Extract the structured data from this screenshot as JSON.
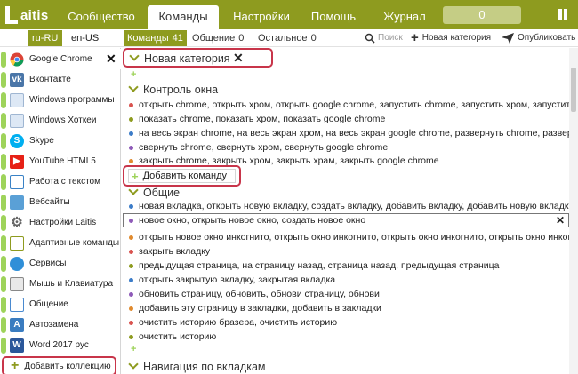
{
  "app": {
    "logo_text": "aitis",
    "logo_color": "#8e9b1f"
  },
  "nav": {
    "tabs": [
      {
        "label": "Сообщество"
      },
      {
        "label": "Команды"
      },
      {
        "label": "Настройки"
      },
      {
        "label": "Помощь"
      },
      {
        "label": "Журнал"
      }
    ],
    "active_tab": "Команды",
    "counter": "0"
  },
  "subbar": {
    "languages": [
      "ru-RU",
      "en-US"
    ],
    "active_language": "ru-RU",
    "filters": [
      {
        "label": "Команды",
        "count": "41"
      },
      {
        "label": "Общение",
        "count": "0"
      },
      {
        "label": "Остальное",
        "count": "0"
      }
    ],
    "search_placeholder": "Поиск",
    "new_category": "Новая категория",
    "publish": "Опубликовать"
  },
  "sidebar": {
    "items": [
      {
        "label": "Google Chrome",
        "icon": "chrome-icon",
        "color": "#db4437"
      },
      {
        "label": "Вконтакте",
        "icon": "vk-icon",
        "color": "#4a76a8"
      },
      {
        "label": "Windows программы",
        "icon": "windows-icon",
        "color": "#3c78c8"
      },
      {
        "label": "Windows Хоткеи",
        "icon": "windows-icon",
        "color": "#3c78c8"
      },
      {
        "label": "Skype",
        "icon": "skype-icon",
        "color": "#00aff0"
      },
      {
        "label": "YouTube HTML5",
        "icon": "youtube-icon",
        "color": "#e62117"
      },
      {
        "label": "Работа с текстом",
        "icon": "document-icon",
        "color": "#3a82c6"
      },
      {
        "label": "Вебсайты",
        "icon": "web-icon",
        "color": "#5aa0d6"
      },
      {
        "label": "Настройки Laitis",
        "icon": "gear-icon",
        "color": "#666666"
      },
      {
        "label": "Адаптивные команды",
        "icon": "adaptive-icon",
        "color": "#8e9b1f"
      },
      {
        "label": "Сервисы",
        "icon": "services-icon",
        "color": "#2f8fd8"
      },
      {
        "label": "Мышь и Клавиатура",
        "icon": "keyboard-icon",
        "color": "#555555"
      },
      {
        "label": "Общение",
        "icon": "chat-icon",
        "color": "#4a8ad0"
      },
      {
        "label": "Автозамена",
        "icon": "autoreplace-icon",
        "color": "#3a7cc0"
      },
      {
        "label": "Word 2017 рус",
        "icon": "word-icon",
        "color": "#2b579a"
      }
    ],
    "add_collection": "Добавить коллекцию"
  },
  "main": {
    "new_category_label": "Новая категория",
    "category1": {
      "title": "Контроль окна",
      "commands": [
        {
          "text": "открыть chrome, открыть хром, открыть google chrome, запустить chrome, запустить хром, запустить google chrome",
          "color": "#d9534f"
        },
        {
          "text": "показать chrome, показать хром, показать google chrome",
          "color": "#8e9b1f"
        },
        {
          "text": "на весь экран chrome, на весь экран хром, на весь экран google chrome, развернуть chrome, развернуть хром, р...",
          "color": "#3c7cc8"
        },
        {
          "text": "свернуть chrome, свернуть хром, свернуть google chrome",
          "color": "#8e5ab8"
        },
        {
          "text": "закрыть chrome, закрыть хром, закрыть храм, закрыть google chrome",
          "color": "#e08a2e"
        }
      ],
      "add_command": "Добавить команду"
    },
    "category2": {
      "title": "Общие",
      "commands": [
        {
          "text": "новая вкладка, открыть новую вкладку, создать вкладку, добавить вкладку, добавить новую вкладку",
          "color": "#3c7cc8"
        },
        {
          "text": "новое окно, открыть новое окно, создать новое окно",
          "color": "#8e5ab8"
        },
        {
          "text": "открыть новое окно инкогнито, открыть окно инкогнито, открыть окно инкогнито, открыть окно инкогнито...",
          "color": "#e08a2e"
        },
        {
          "text": "закрыть вкладку",
          "color": "#d9534f"
        },
        {
          "text": "предыдущая страница, на страницу назад, страница назад, предыдущая страница",
          "color": "#8e9b1f"
        },
        {
          "text": "открыть закрытую вкладку, закрытая вкладка",
          "color": "#3c7cc8"
        },
        {
          "text": "обновить страницу, обновить, обнови страницу, обнови",
          "color": "#8e5ab8"
        },
        {
          "text": "добавить эту страницу в закладки, добавить в закладки",
          "color": "#e08a2e"
        },
        {
          "text": "очистить историю бразера, очистить историю",
          "color": "#d9534f"
        },
        {
          "text": "очистить историю",
          "color": "#8e9b1f"
        }
      ]
    },
    "category3": {
      "title": "Навигация по вкладкам"
    }
  }
}
